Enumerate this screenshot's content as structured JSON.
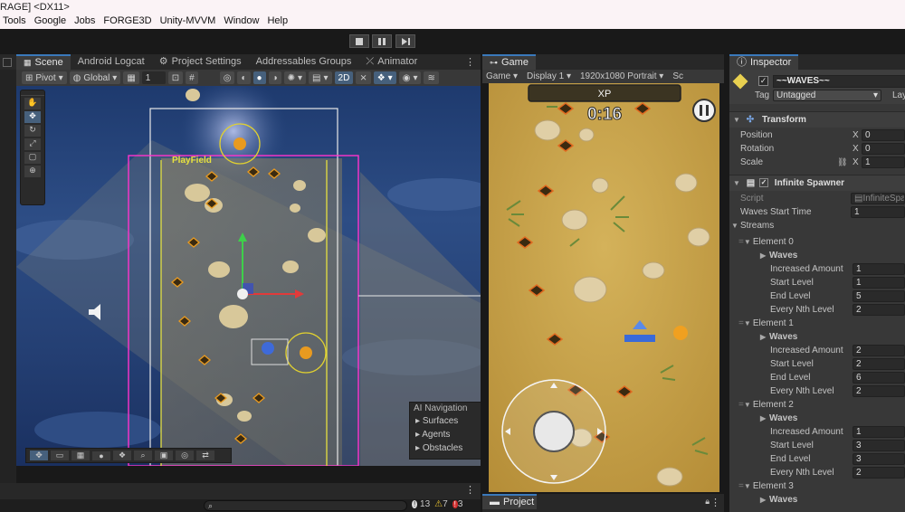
{
  "window": {
    "title": "RAGE] <DX11>"
  },
  "menu": [
    "Tools",
    "Google",
    "Jobs",
    "FORGE3D",
    "Unity-MVVM",
    "Window",
    "Help"
  ],
  "scene_panel": {
    "tabs": [
      {
        "label": "Scene",
        "active": true
      },
      {
        "label": "Android Logcat"
      },
      {
        "label": "Project Settings"
      },
      {
        "label": "Addressables Groups"
      },
      {
        "label": "Animator"
      }
    ],
    "toolbar": {
      "pivot": "Pivot",
      "global": "Global",
      "grid_value": "1",
      "mode_2d": "2D"
    },
    "playfield_label": "PlayField",
    "overlay": {
      "title": "AI Navigation",
      "items": [
        "Surfaces",
        "Agents",
        "Obstacles"
      ]
    }
  },
  "game_panel": {
    "tab": "Game",
    "mode": "Game",
    "display": "Display 1",
    "resolution": "1920x1080 Portrait",
    "extra": "Sc",
    "hud": {
      "xp_label": "XP",
      "timer": "0:16"
    }
  },
  "inspector": {
    "tab": "Inspector",
    "object_name": "~~WAVES~~",
    "tag_label": "Tag",
    "tag_value": "Untagged",
    "layer_label": "Lay",
    "transform": {
      "header": "Transform",
      "position_label": "Position",
      "position_x": "0",
      "rotation_label": "Rotation",
      "rotation_x": "0",
      "scale_label": "Scale",
      "scale_x": "1",
      "axis": "X"
    },
    "spawner": {
      "header": "Infinite Spawner",
      "script_label": "Script",
      "script_value": "InfiniteSpaw",
      "waves_start_label": "Waves Start Time",
      "waves_start_value": "1",
      "streams_label": "Streams",
      "elements": [
        {
          "name": "Element 0",
          "increased_amount": "1",
          "start_level": "1",
          "end_level": "5",
          "every_nth_level": "2"
        },
        {
          "name": "Element 1",
          "increased_amount": "2",
          "start_level": "2",
          "end_level": "6",
          "every_nth_level": "2"
        },
        {
          "name": "Element 2",
          "increased_amount": "1",
          "start_level": "3",
          "end_level": "3",
          "every_nth_level": "2"
        },
        {
          "name": "Element 3"
        }
      ],
      "waves_label": "Waves",
      "increased_amount_label": "Increased Amount",
      "start_level_label": "Start Level",
      "end_level_label": "End Level",
      "every_nth_label": "Every Nth Level"
    }
  },
  "project_panel": {
    "tab": "Project"
  },
  "status": {
    "info_count": "13",
    "warn_count": "7",
    "error_count": "3"
  },
  "colors": {
    "accent": "#3a79bb",
    "playfield": "#ff33cc",
    "sand": "#c8a24a"
  }
}
